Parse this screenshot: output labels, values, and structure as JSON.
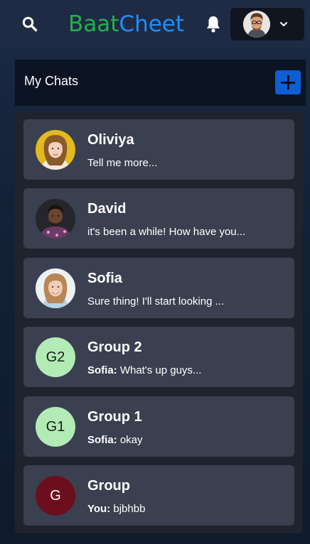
{
  "navbar": {
    "brand_part1": "Baat",
    "brand_part2": "Cheet",
    "search_icon": "search-icon",
    "bell_icon": "bell-icon",
    "profile_chevron": "chevron-down-icon"
  },
  "chats": {
    "title": "My Chats",
    "add_icon": "plus-icon",
    "items": [
      {
        "name": "Oliviya",
        "sender": "",
        "preview": "Tell me more..."
      },
      {
        "name": "David",
        "sender": "",
        "preview": "it's been a while! How have you..."
      },
      {
        "name": "Sofia",
        "sender": "",
        "preview": "Sure thing! I'll start looking ..."
      },
      {
        "name": "Group 2",
        "initials": "G2",
        "sender": "Sofia:",
        "preview": " What's up guys..."
      },
      {
        "name": "Group 1",
        "initials": "G1",
        "sender": "Sofia:",
        "preview": " okay"
      },
      {
        "name": "Group",
        "initials": "G",
        "sender": "You:",
        "preview": " bjbhbb"
      }
    ]
  },
  "colors": {
    "brand_green": "#22b14c",
    "brand_blue": "#1f8fff",
    "add_button": "#0d5fd3",
    "card": "#3b4050",
    "group_avatar_light": "#b3ebb6",
    "group_avatar_dark": "#6b0f1f"
  }
}
